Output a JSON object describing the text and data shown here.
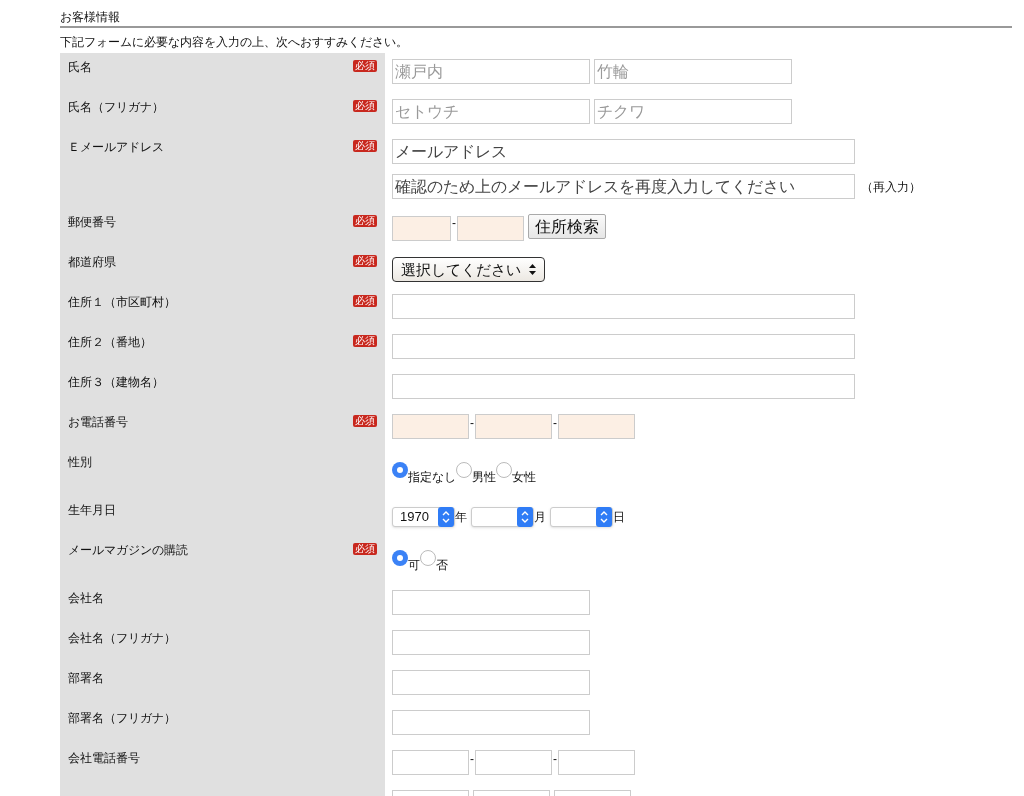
{
  "section_title": "お客様情報",
  "intro": "下記フォームに必要な内容を入力の上、次へおすすみください。",
  "rows": [
    {
      "kind": "pair",
      "label": "氏名",
      "badge": "必須",
      "fields": [
        {
          "placeholder": "瀬戸内"
        },
        {
          "placeholder": "竹輪"
        }
      ]
    },
    {
      "kind": "pair",
      "label": "氏名（フリガナ）",
      "badge": "必須",
      "fields": [
        {
          "placeholder": "セトウチ"
        },
        {
          "placeholder": "チクワ"
        }
      ]
    },
    {
      "kind": "email",
      "label": "Ｅメールアドレス",
      "badge": "必須",
      "fields": [
        {
          "placeholder": "メールアドレス"
        },
        {
          "placeholder": "確認のため上のメールアドレスを再度入力してください",
          "note": "（再入力）"
        }
      ]
    },
    {
      "kind": "postal",
      "label": "郵便番号",
      "badge": "必須",
      "tinted": true,
      "separator": "-",
      "button": "住所検索"
    },
    {
      "kind": "select",
      "label": "都道府県",
      "badge": "必須",
      "value": "選択してください"
    },
    {
      "kind": "wide",
      "label": "住所１（市区町村）",
      "badge": "必須"
    },
    {
      "kind": "wide",
      "label": "住所２（番地）",
      "badge": "必須"
    },
    {
      "kind": "wide",
      "label": "住所３（建物名）"
    },
    {
      "kind": "tel",
      "label": "お電話番号",
      "badge": "必須",
      "tinted": true,
      "separators": [
        "-",
        "-"
      ]
    },
    {
      "kind": "radio",
      "label": "性別",
      "options": [
        {
          "label": "指定なし",
          "selected": true
        },
        {
          "label": "男性",
          "selected": false
        },
        {
          "label": "女性",
          "selected": false
        }
      ]
    },
    {
      "kind": "date",
      "label": "生年月日",
      "selects": [
        {
          "value": "1970",
          "unit": "年"
        },
        {
          "unit": "月"
        },
        {
          "unit": "日"
        }
      ]
    },
    {
      "kind": "radio",
      "label": "メールマガジンの購読",
      "badge": "必須",
      "options": [
        {
          "label": "可",
          "selected": true
        },
        {
          "label": "否",
          "selected": false
        }
      ]
    },
    {
      "kind": "short",
      "label": "会社名"
    },
    {
      "kind": "short",
      "label": "会社名（フリガナ）"
    },
    {
      "kind": "short",
      "label": "部署名"
    },
    {
      "kind": "short",
      "label": "部署名（フリガナ）"
    },
    {
      "kind": "tel",
      "label": "会社電話番号",
      "tinted": false,
      "separators": [
        "-",
        "-"
      ]
    },
    {
      "kind": "tel",
      "tinted": false
    }
  ]
}
